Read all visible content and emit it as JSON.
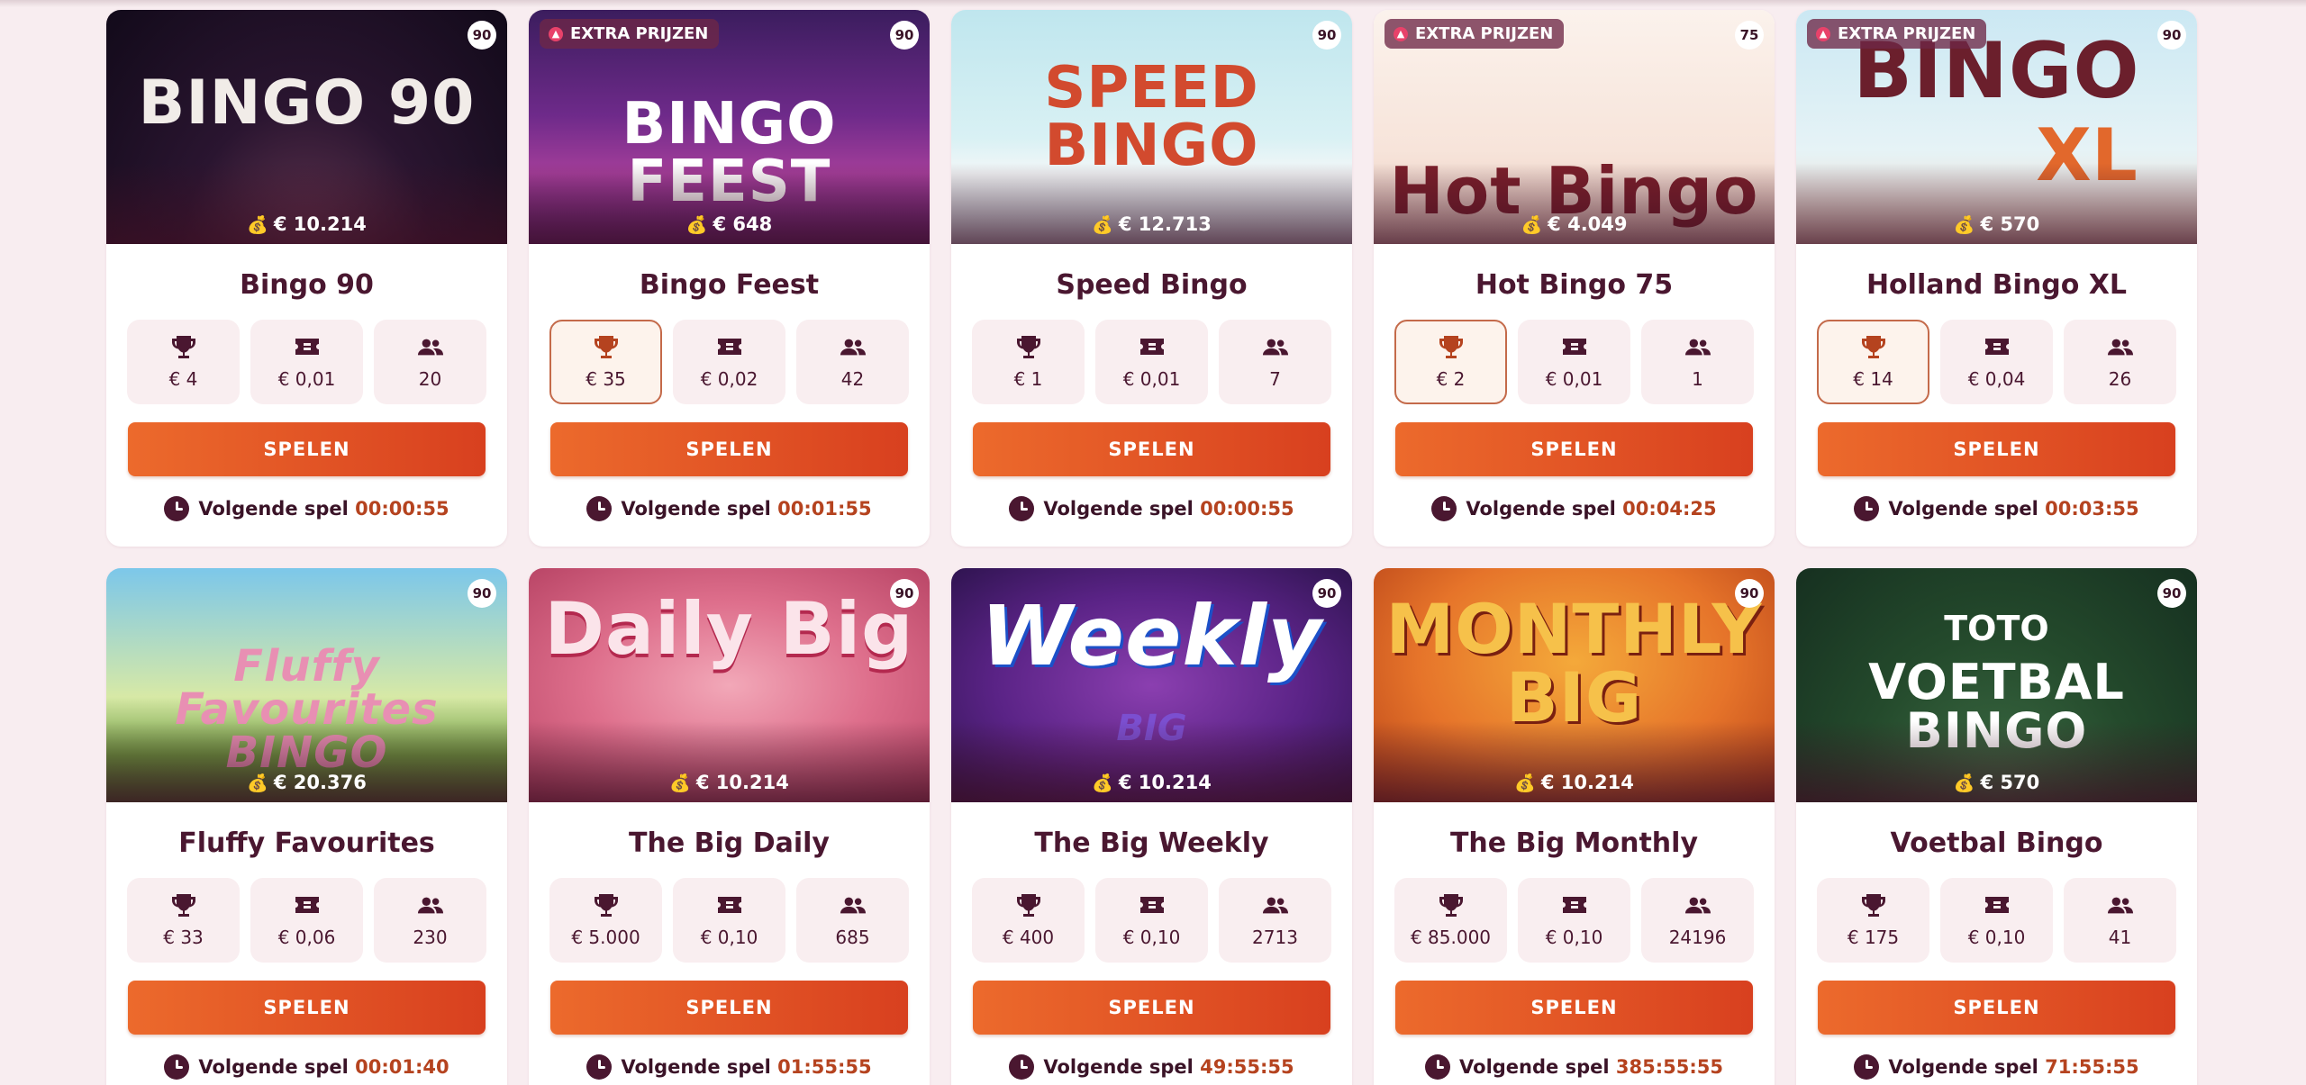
{
  "games": [
    {
      "name": "Bingo 90",
      "banner": "BINGO 90",
      "badge": "90",
      "extra": "",
      "jackpot": "€ 10.214",
      "prize": "€ 4",
      "ticket": "€ 0,01",
      "players": "20",
      "highlight": false,
      "next_label": "Volgende spel",
      "next_time": "00:00:55",
      "button": "SPELEN"
    },
    {
      "name": "Bingo Feest",
      "banner": "BINGO FEEST",
      "badge": "90",
      "extra": "EXTRA PRIJZEN",
      "jackpot": "€ 648",
      "prize": "€ 35",
      "ticket": "€ 0,02",
      "players": "42",
      "highlight": true,
      "next_label": "Volgende spel",
      "next_time": "00:01:55",
      "button": "SPELEN"
    },
    {
      "name": "Speed Bingo",
      "banner": "SPEED BINGO",
      "badge": "90",
      "extra": "",
      "jackpot": "€ 12.713",
      "prize": "€ 1",
      "ticket": "€ 0,01",
      "players": "7",
      "highlight": false,
      "next_label": "Volgende spel",
      "next_time": "00:00:55",
      "button": "SPELEN"
    },
    {
      "name": "Hot Bingo 75",
      "banner": "Hot Bingo",
      "badge": "75",
      "extra": "EXTRA PRIJZEN",
      "jackpot": "€ 4.049",
      "prize": "€ 2",
      "ticket": "€ 0,01",
      "players": "1",
      "highlight": true,
      "next_label": "Volgende spel",
      "next_time": "00:04:25",
      "button": "SPELEN"
    },
    {
      "name": "Holland Bingo XL",
      "banner": "BINGO",
      "badge": "90",
      "extra": "EXTRA PRIJZEN",
      "jackpot": "€ 570",
      "prize": "€ 14",
      "ticket": "€ 0,04",
      "players": "26",
      "highlight": true,
      "next_label": "Volgende spel",
      "next_time": "00:03:55",
      "button": "SPELEN"
    },
    {
      "name": "Fluffy Favourites",
      "banner": "Fluffy Favourites BINGO",
      "badge": "90",
      "extra": "",
      "jackpot": "€ 20.376",
      "prize": "€ 33",
      "ticket": "€ 0,06",
      "players": "230",
      "highlight": false,
      "next_label": "Volgende spel",
      "next_time": "00:01:40",
      "button": "SPELEN"
    },
    {
      "name": "The Big Daily",
      "banner": "Daily Big",
      "badge": "90",
      "extra": "",
      "jackpot": "€ 10.214",
      "prize": "€ 5.000",
      "ticket": "€ 0,10",
      "players": "685",
      "highlight": false,
      "next_label": "Volgende spel",
      "next_time": "01:55:55",
      "button": "SPELEN"
    },
    {
      "name": "The Big Weekly",
      "banner": "Weekly",
      "badge": "90",
      "extra": "",
      "jackpot": "€ 10.214",
      "prize": "€ 400",
      "ticket": "€ 0,10",
      "players": "2713",
      "highlight": false,
      "next_label": "Volgende spel",
      "next_time": "49:55:55",
      "button": "SPELEN"
    },
    {
      "name": "The Big Monthly",
      "banner": "MONTHLY BIG",
      "badge": "90",
      "extra": "",
      "jackpot": "€ 10.214",
      "prize": "€ 85.000",
      "ticket": "€ 0,10",
      "players": "24196",
      "highlight": false,
      "next_label": "Volgende spel",
      "next_time": "385:55:55",
      "button": "SPELEN"
    },
    {
      "name": "Voetbal Bingo",
      "banner": "VOETBAL BINGO",
      "badge": "90",
      "extra": "",
      "jackpot": "€ 570",
      "prize": "€ 175",
      "ticket": "€ 0,10",
      "players": "41",
      "highlight": false,
      "next_label": "Volgende spel",
      "next_time": "71:55:55",
      "button": "SPELEN"
    }
  ],
  "extras": {
    "weekly_sub": "BIG",
    "xl_text": "XL",
    "toto_text": "TOTO"
  },
  "colors": {
    "background": "#f8edf0",
    "button_start": "#ec6a2c",
    "button_end": "#d8401f",
    "text_dark": "#4a1730",
    "time_accent": "#b5431f"
  },
  "icons": [
    "trophy-icon",
    "ticket-icon",
    "players-icon",
    "clock-icon",
    "money-bag-icon",
    "flame-icon"
  ]
}
